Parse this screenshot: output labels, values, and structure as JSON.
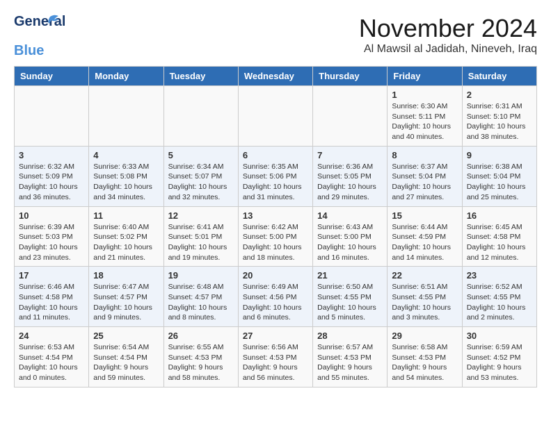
{
  "logo": {
    "line1": "General",
    "line2": "Blue"
  },
  "title": "November 2024",
  "location": "Al Mawsil al Jadidah, Nineveh, Iraq",
  "headers": [
    "Sunday",
    "Monday",
    "Tuesday",
    "Wednesday",
    "Thursday",
    "Friday",
    "Saturday"
  ],
  "weeks": [
    [
      {
        "day": "",
        "info": ""
      },
      {
        "day": "",
        "info": ""
      },
      {
        "day": "",
        "info": ""
      },
      {
        "day": "",
        "info": ""
      },
      {
        "day": "",
        "info": ""
      },
      {
        "day": "1",
        "info": "Sunrise: 6:30 AM\nSunset: 5:11 PM\nDaylight: 10 hours\nand 40 minutes."
      },
      {
        "day": "2",
        "info": "Sunrise: 6:31 AM\nSunset: 5:10 PM\nDaylight: 10 hours\nand 38 minutes."
      }
    ],
    [
      {
        "day": "3",
        "info": "Sunrise: 6:32 AM\nSunset: 5:09 PM\nDaylight: 10 hours\nand 36 minutes."
      },
      {
        "day": "4",
        "info": "Sunrise: 6:33 AM\nSunset: 5:08 PM\nDaylight: 10 hours\nand 34 minutes."
      },
      {
        "day": "5",
        "info": "Sunrise: 6:34 AM\nSunset: 5:07 PM\nDaylight: 10 hours\nand 32 minutes."
      },
      {
        "day": "6",
        "info": "Sunrise: 6:35 AM\nSunset: 5:06 PM\nDaylight: 10 hours\nand 31 minutes."
      },
      {
        "day": "7",
        "info": "Sunrise: 6:36 AM\nSunset: 5:05 PM\nDaylight: 10 hours\nand 29 minutes."
      },
      {
        "day": "8",
        "info": "Sunrise: 6:37 AM\nSunset: 5:04 PM\nDaylight: 10 hours\nand 27 minutes."
      },
      {
        "day": "9",
        "info": "Sunrise: 6:38 AM\nSunset: 5:04 PM\nDaylight: 10 hours\nand 25 minutes."
      }
    ],
    [
      {
        "day": "10",
        "info": "Sunrise: 6:39 AM\nSunset: 5:03 PM\nDaylight: 10 hours\nand 23 minutes."
      },
      {
        "day": "11",
        "info": "Sunrise: 6:40 AM\nSunset: 5:02 PM\nDaylight: 10 hours\nand 21 minutes."
      },
      {
        "day": "12",
        "info": "Sunrise: 6:41 AM\nSunset: 5:01 PM\nDaylight: 10 hours\nand 19 minutes."
      },
      {
        "day": "13",
        "info": "Sunrise: 6:42 AM\nSunset: 5:00 PM\nDaylight: 10 hours\nand 18 minutes."
      },
      {
        "day": "14",
        "info": "Sunrise: 6:43 AM\nSunset: 5:00 PM\nDaylight: 10 hours\nand 16 minutes."
      },
      {
        "day": "15",
        "info": "Sunrise: 6:44 AM\nSunset: 4:59 PM\nDaylight: 10 hours\nand 14 minutes."
      },
      {
        "day": "16",
        "info": "Sunrise: 6:45 AM\nSunset: 4:58 PM\nDaylight: 10 hours\nand 12 minutes."
      }
    ],
    [
      {
        "day": "17",
        "info": "Sunrise: 6:46 AM\nSunset: 4:58 PM\nDaylight: 10 hours\nand 11 minutes."
      },
      {
        "day": "18",
        "info": "Sunrise: 6:47 AM\nSunset: 4:57 PM\nDaylight: 10 hours\nand 9 minutes."
      },
      {
        "day": "19",
        "info": "Sunrise: 6:48 AM\nSunset: 4:57 PM\nDaylight: 10 hours\nand 8 minutes."
      },
      {
        "day": "20",
        "info": "Sunrise: 6:49 AM\nSunset: 4:56 PM\nDaylight: 10 hours\nand 6 minutes."
      },
      {
        "day": "21",
        "info": "Sunrise: 6:50 AM\nSunset: 4:55 PM\nDaylight: 10 hours\nand 5 minutes."
      },
      {
        "day": "22",
        "info": "Sunrise: 6:51 AM\nSunset: 4:55 PM\nDaylight: 10 hours\nand 3 minutes."
      },
      {
        "day": "23",
        "info": "Sunrise: 6:52 AM\nSunset: 4:55 PM\nDaylight: 10 hours\nand 2 minutes."
      }
    ],
    [
      {
        "day": "24",
        "info": "Sunrise: 6:53 AM\nSunset: 4:54 PM\nDaylight: 10 hours\nand 0 minutes."
      },
      {
        "day": "25",
        "info": "Sunrise: 6:54 AM\nSunset: 4:54 PM\nDaylight: 9 hours\nand 59 minutes."
      },
      {
        "day": "26",
        "info": "Sunrise: 6:55 AM\nSunset: 4:53 PM\nDaylight: 9 hours\nand 58 minutes."
      },
      {
        "day": "27",
        "info": "Sunrise: 6:56 AM\nSunset: 4:53 PM\nDaylight: 9 hours\nand 56 minutes."
      },
      {
        "day": "28",
        "info": "Sunrise: 6:57 AM\nSunset: 4:53 PM\nDaylight: 9 hours\nand 55 minutes."
      },
      {
        "day": "29",
        "info": "Sunrise: 6:58 AM\nSunset: 4:53 PM\nDaylight: 9 hours\nand 54 minutes."
      },
      {
        "day": "30",
        "info": "Sunrise: 6:59 AM\nSunset: 4:52 PM\nDaylight: 9 hours\nand 53 minutes."
      }
    ]
  ]
}
